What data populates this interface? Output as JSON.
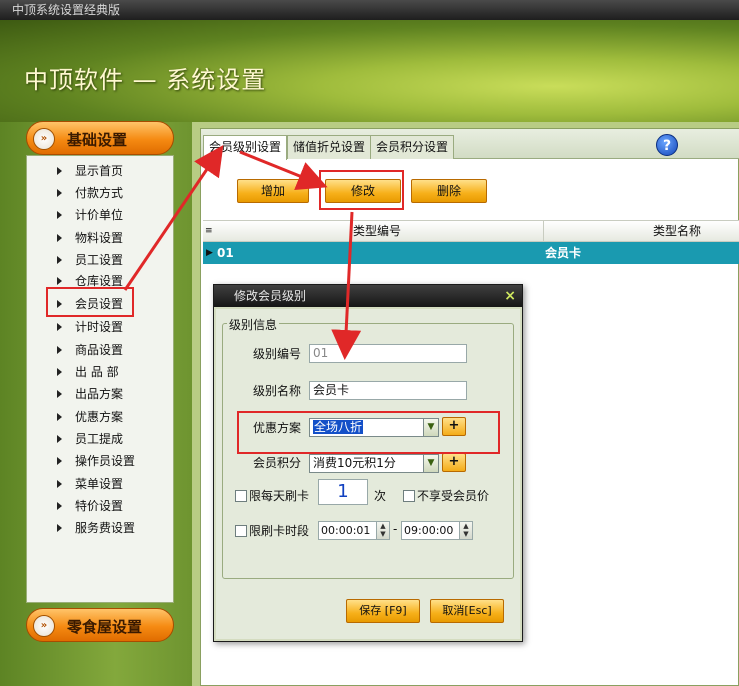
{
  "window": {
    "title": "中顶系统设置经典版"
  },
  "banner": {
    "title": "中顶软件 — 系统设置"
  },
  "sidebar": {
    "group1_label": "基础设置",
    "group2_label": "零食屋设置",
    "items": [
      "显示首页",
      "付款方式",
      "计价单位",
      "物料设置",
      "员工设置",
      "仓库设置",
      "会员设置",
      "计时设置",
      "商品设置",
      "出 品 部",
      "出品方案",
      "优惠方案",
      "员工提成",
      "操作员设置",
      "菜单设置",
      "特价设置",
      "服务费设置"
    ]
  },
  "tabs": [
    "会员级别设置",
    "储值折兑设置",
    "会员积分设置"
  ],
  "toolbar": {
    "add_label": "增加",
    "edit_label": "修改",
    "delete_label": "删除"
  },
  "grid": {
    "columns": [
      "类型编号",
      "类型名称"
    ],
    "rows": [
      {
        "code": "01",
        "name": "会员卡"
      }
    ]
  },
  "dialog": {
    "title": "修改会员级别",
    "close": "×",
    "group_label": "级别信息",
    "code_label": "级别编号",
    "code_value": "01",
    "name_label": "级别名称",
    "name_value": "会员卡",
    "discount_label": "优惠方案",
    "discount_value": "全场八折",
    "points_label": "会员积分",
    "points_value": "消费10元积1分",
    "daily_label": "限每天刷卡",
    "daily_value": "1",
    "daily_unit": "次",
    "no_member_price_label": "不享受会员价",
    "time_label": "限刷卡时段",
    "time_start": "00:00:01",
    "time_sep": "-",
    "time_end": "09:00:00",
    "save_label": "保存 [F9]",
    "cancel_label": "取消[Esc]",
    "plus": "+"
  },
  "colors": {
    "accent_orange": "#f58a12",
    "selection_teal": "#1a9ab0",
    "annotation_red": "#e02828"
  }
}
